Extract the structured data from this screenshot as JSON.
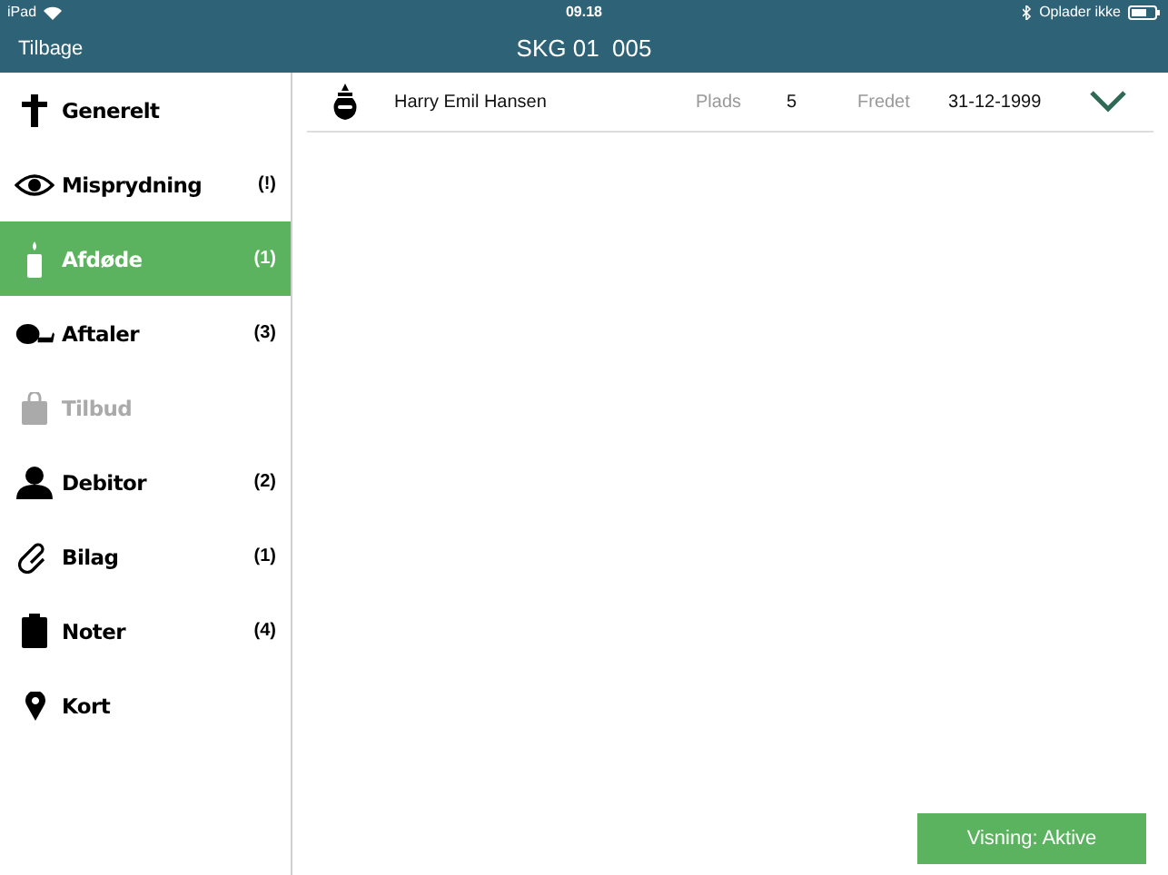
{
  "status_bar": {
    "device": "iPad",
    "time": "09.18",
    "charging": "Oplader ikke"
  },
  "nav": {
    "back": "Tilbage",
    "title": "SKG 01  005"
  },
  "sidebar": {
    "items": [
      {
        "kind": "cross",
        "label": "Generelt",
        "selected": false,
        "disabled": false
      },
      {
        "kind": "eye",
        "label": "Misprydning",
        "count": "(!)",
        "selected": false,
        "disabled": false
      },
      {
        "kind": "candle",
        "label": "Afdøde",
        "count": "(1)",
        "selected": true,
        "disabled": false
      },
      {
        "kind": "can",
        "label": "Aftaler",
        "count": "(3)",
        "selected": false,
        "disabled": false
      },
      {
        "kind": "bag",
        "label": "Tilbud",
        "selected": false,
        "disabled": true
      },
      {
        "kind": "person",
        "label": "Debitor",
        "count": "(2)",
        "selected": false,
        "disabled": false
      },
      {
        "kind": "clip",
        "label": "Bilag",
        "count": "(1)",
        "selected": false,
        "disabled": false
      },
      {
        "kind": "clipboard",
        "label": "Noter",
        "count": "(4)",
        "selected": false,
        "disabled": false
      },
      {
        "kind": "pin",
        "label": "Kort",
        "selected": false,
        "disabled": false
      }
    ]
  },
  "deceased": [
    {
      "name": "Harry Emil Hansen",
      "place_label": "Plads",
      "place": "5",
      "status_label": "Fredet",
      "date": "31-12-1999"
    }
  ],
  "view_button": "Visning: Aktive"
}
